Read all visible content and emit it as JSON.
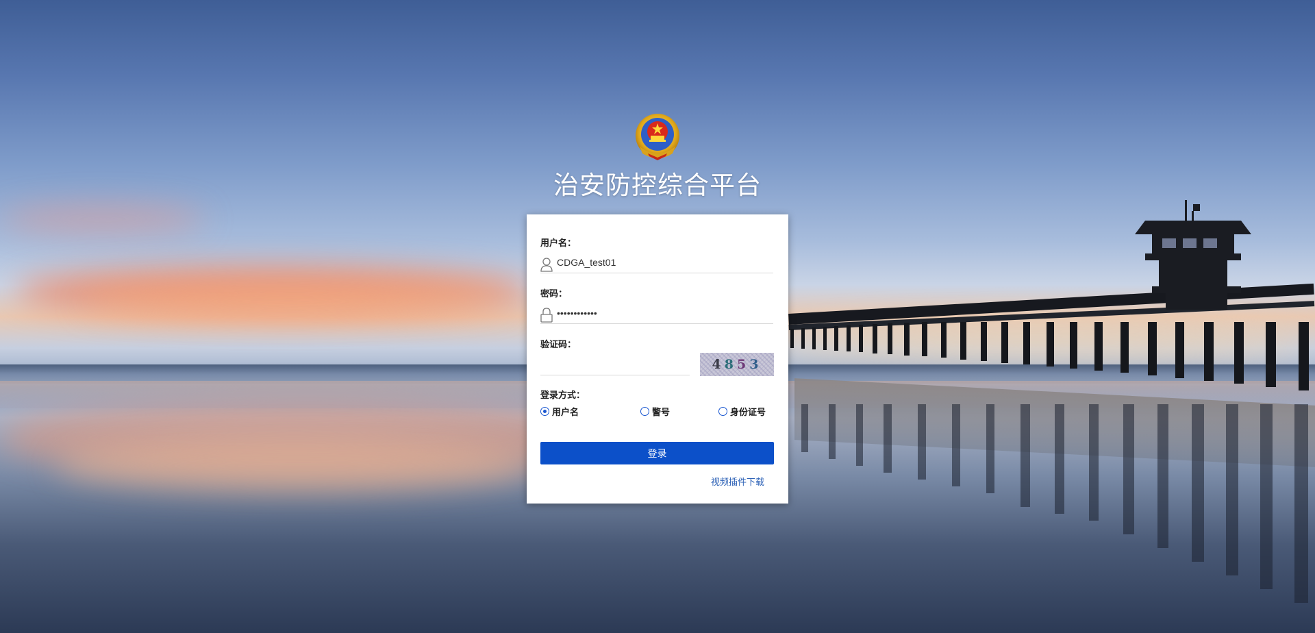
{
  "header": {
    "title": "治安防控综合平台"
  },
  "login": {
    "username_label": "用户名：",
    "username_value": "CDGA_test01",
    "password_label": "密码：",
    "password_value": "••••••••••••",
    "captcha_label": "验证码：",
    "captcha_value": "",
    "captcha_text": "4853",
    "method_label": "登录方式：",
    "methods": [
      {
        "label": "用户名",
        "selected": true
      },
      {
        "label": "警号",
        "selected": false
      },
      {
        "label": "身份证号",
        "selected": false
      }
    ],
    "submit_label": "登录",
    "plugin_link": "视频插件下载"
  },
  "colors": {
    "primary": "#0c50c9",
    "link": "#2f63b7",
    "radio": "#1a57d0"
  },
  "icons": [
    "emblem-icon",
    "user-icon",
    "lock-icon"
  ]
}
